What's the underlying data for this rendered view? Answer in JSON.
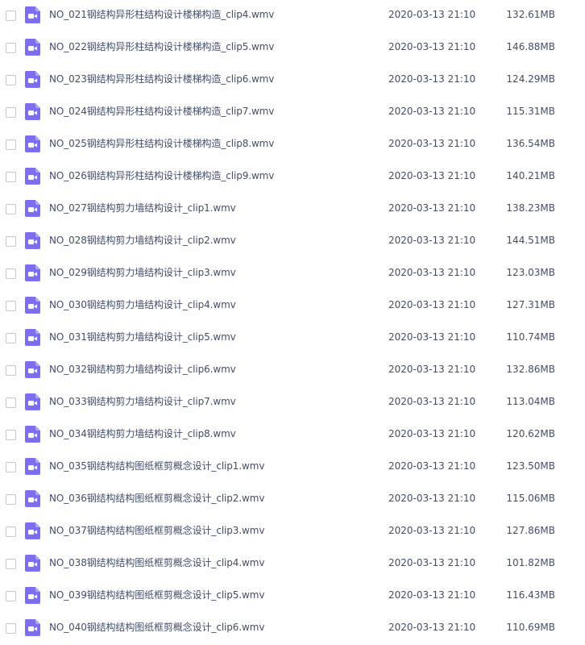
{
  "icon_color": "#7b6ff0",
  "icon_name": "video-file-icon",
  "files": [
    {
      "name": "NO_021钢结构异形柱结构设计楼梯构造_clip4.wmv",
      "date": "2020-03-13 21:10",
      "size": "132.61MB"
    },
    {
      "name": "NO_022钢结构异形柱结构设计楼梯构造_clip5.wmv",
      "date": "2020-03-13 21:10",
      "size": "146.88MB"
    },
    {
      "name": "NO_023钢结构异形柱结构设计楼梯构造_clip6.wmv",
      "date": "2020-03-13 21:10",
      "size": "124.29MB"
    },
    {
      "name": "NO_024钢结构异形柱结构设计楼梯构造_clip7.wmv",
      "date": "2020-03-13 21:10",
      "size": "115.31MB"
    },
    {
      "name": "NO_025钢结构异形柱结构设计楼梯构造_clip8.wmv",
      "date": "2020-03-13 21:10",
      "size": "136.54MB"
    },
    {
      "name": "NO_026钢结构异形柱结构设计楼梯构造_clip9.wmv",
      "date": "2020-03-13 21:10",
      "size": "140.21MB"
    },
    {
      "name": "NO_027钢结构剪力墙结构设计_clip1.wmv",
      "date": "2020-03-13 21:10",
      "size": "138.23MB"
    },
    {
      "name": "NO_028钢结构剪力墙结构设计_clip2.wmv",
      "date": "2020-03-13 21:10",
      "size": "144.51MB"
    },
    {
      "name": "NO_029钢结构剪力墙结构设计_clip3.wmv",
      "date": "2020-03-13 21:10",
      "size": "123.03MB"
    },
    {
      "name": "NO_030钢结构剪力墙结构设计_clip4.wmv",
      "date": "2020-03-13 21:10",
      "size": "127.31MB"
    },
    {
      "name": "NO_031钢结构剪力墙结构设计_clip5.wmv",
      "date": "2020-03-13 21:10",
      "size": "110.74MB"
    },
    {
      "name": "NO_032钢结构剪力墙结构设计_clip6.wmv",
      "date": "2020-03-13 21:10",
      "size": "132.86MB"
    },
    {
      "name": "NO_033钢结构剪力墙结构设计_clip7.wmv",
      "date": "2020-03-13 21:10",
      "size": "113.04MB"
    },
    {
      "name": "NO_034钢结构剪力墙结构设计_clip8.wmv",
      "date": "2020-03-13 21:10",
      "size": "120.62MB"
    },
    {
      "name": "NO_035钢结构结构图纸框剪概念设计_clip1.wmv",
      "date": "2020-03-13 21:10",
      "size": "123.50MB"
    },
    {
      "name": "NO_036钢结构结构图纸框剪概念设计_clip2.wmv",
      "date": "2020-03-13 21:10",
      "size": "115.06MB"
    },
    {
      "name": "NO_037钢结构结构图纸框剪概念设计_clip3.wmv",
      "date": "2020-03-13 21:10",
      "size": "127.86MB"
    },
    {
      "name": "NO_038钢结构结构图纸框剪概念设计_clip4.wmv",
      "date": "2020-03-13 21:10",
      "size": "101.82MB"
    },
    {
      "name": "NO_039钢结构结构图纸框剪概念设计_clip5.wmv",
      "date": "2020-03-13 21:10",
      "size": "116.43MB"
    },
    {
      "name": "NO_040钢结构结构图纸框剪概念设计_clip6.wmv",
      "date": "2020-03-13 21:10",
      "size": "110.69MB"
    }
  ]
}
